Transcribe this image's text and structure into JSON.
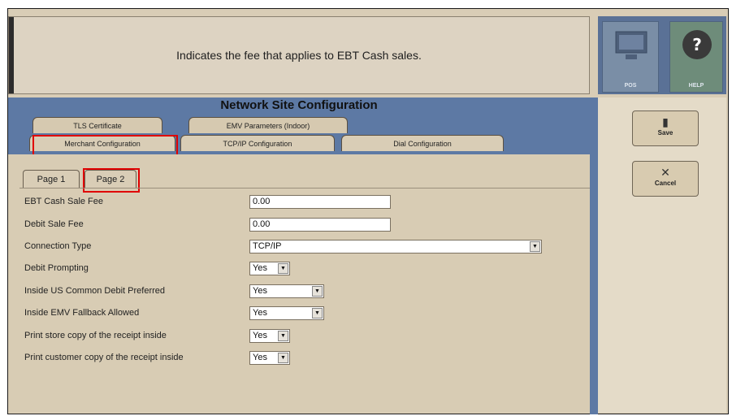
{
  "info": {
    "text": "Indicates the fee that applies to EBT Cash sales."
  },
  "top_buttons": {
    "pos_label": "POS",
    "help_label": "HELP"
  },
  "panel": {
    "title": "Network Site Configuration",
    "tabs_back": [
      "TLS Certificate",
      "EMV Parameters (Indoor)"
    ],
    "tabs_front": [
      "Merchant Configuration",
      "TCP/IP Configuration",
      "Dial Configuration"
    ],
    "active_tab": "Merchant Configuration"
  },
  "pages": {
    "page1": "Page 1",
    "page2": "Page 2",
    "active": "Page 2"
  },
  "fields": [
    {
      "label": "EBT Cash Sale Fee",
      "value": "0.00"
    },
    {
      "label": "Debit Sale Fee",
      "value": "0.00"
    },
    {
      "label": "Connection Type",
      "value": "TCP/IP"
    },
    {
      "label": "Debit Prompting",
      "value": "Yes"
    },
    {
      "label": "Inside US Common Debit Preferred",
      "value": "Yes"
    },
    {
      "label": "Inside EMV Fallback Allowed",
      "value": "Yes"
    },
    {
      "label": "Print store copy of the receipt inside",
      "value": "Yes"
    },
    {
      "label": "Print customer copy of the receipt inside",
      "value": "Yes"
    }
  ],
  "side_buttons": {
    "save_label": "Save",
    "cancel_label": "Cancel"
  },
  "icons": {
    "pos": "monitor-icon",
    "help": "question-icon",
    "save": "floppy-icon",
    "cancel": "x-icon"
  },
  "colors": {
    "highlight": "#e00000",
    "panel_blue": "#5d79a4"
  }
}
